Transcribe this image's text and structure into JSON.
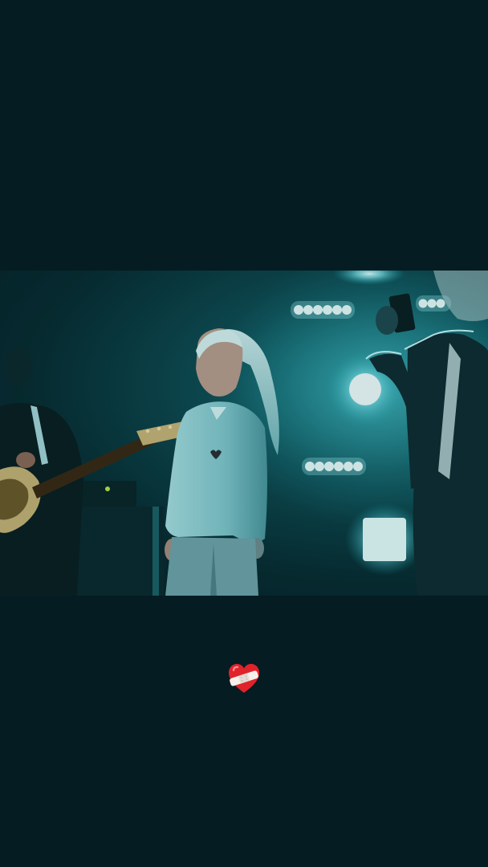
{
  "story": {
    "background_color": "#041c22",
    "photo": {
      "subject": "concert-stage-photo",
      "tint_color": "#1fa3ad"
    },
    "sticker": {
      "icon": "mending-heart-icon",
      "color": "#e0222b"
    }
  }
}
